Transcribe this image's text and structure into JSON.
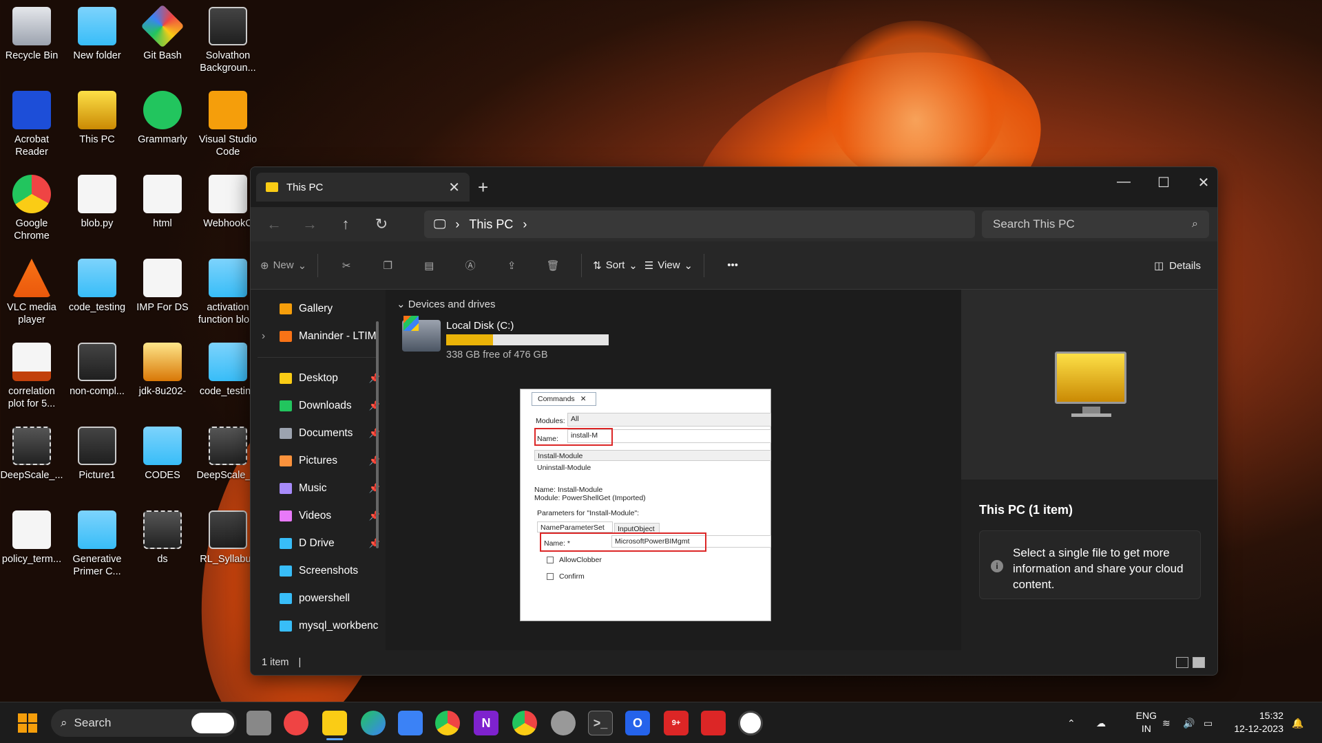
{
  "desktop": {
    "icons": [
      {
        "label": "Recycle Bin",
        "icon": "recycle-bin-icon"
      },
      {
        "label": "New folder",
        "icon": "folder-icon"
      },
      {
        "label": "Git Bash",
        "icon": "git-icon"
      },
      {
        "label": "Solvathon Backgroun...",
        "icon": "image-icon"
      },
      {
        "label": "Acrobat Reader",
        "icon": "acrobat-icon"
      },
      {
        "label": "This PC",
        "icon": "monitor-icon"
      },
      {
        "label": "Grammarly",
        "icon": "grammarly-icon"
      },
      {
        "label": "Visual Studio Code",
        "icon": "vscode-icon"
      },
      {
        "label": "Google Chrome",
        "icon": "chrome-icon"
      },
      {
        "label": "blob.py",
        "icon": "document-icon"
      },
      {
        "label": "html",
        "icon": "document-icon"
      },
      {
        "label": "WebhookC",
        "icon": "document-icon"
      },
      {
        "label": "VLC media player",
        "icon": "vlc-icon"
      },
      {
        "label": "code_testing",
        "icon": "folder-icon"
      },
      {
        "label": "IMP For DS",
        "icon": "document-icon"
      },
      {
        "label": "activation function blo...",
        "icon": "folder-icon"
      },
      {
        "label": "correlation plot for 5...",
        "icon": "word-icon"
      },
      {
        "label": "non-compl...",
        "icon": "image-icon"
      },
      {
        "label": "jdk-8u202-",
        "icon": "archive-icon"
      },
      {
        "label": "code_testing",
        "icon": "folder-icon"
      },
      {
        "label": "DeepScale_...",
        "icon": "video-icon"
      },
      {
        "label": "Picture1",
        "icon": "image-icon"
      },
      {
        "label": "CODES",
        "icon": "folder-icon"
      },
      {
        "label": "DeepScale_...",
        "icon": "video-icon"
      },
      {
        "label": "policy_term...",
        "icon": "document-icon"
      },
      {
        "label": "Generative Primer C...",
        "icon": "folder-icon"
      },
      {
        "label": "ds",
        "icon": "video-icon"
      },
      {
        "label": "RL_Syllabus",
        "icon": "image-icon"
      }
    ]
  },
  "explorer": {
    "tab_title": "This PC",
    "address": "This PC",
    "search_placeholder": "Search This PC",
    "toolbar": {
      "new": "New",
      "sort": "Sort",
      "view": "View",
      "more": "•••",
      "details": "Details"
    },
    "sidebar": [
      {
        "label": "Gallery",
        "color": "#f59e0b",
        "pinned": false
      },
      {
        "label": "Maninder - LTIM",
        "color": "#f97316",
        "pinned": false,
        "expandable": true
      },
      {
        "label": "Desktop",
        "color": "#facc15",
        "pinned": true
      },
      {
        "label": "Downloads",
        "color": "#22c55e",
        "pinned": true
      },
      {
        "label": "Documents",
        "color": "#9ca3af",
        "pinned": true
      },
      {
        "label": "Pictures",
        "color": "#fb923c",
        "pinned": true
      },
      {
        "label": "Music",
        "color": "#a78bfa",
        "pinned": true
      },
      {
        "label": "Videos",
        "color": "#e879f9",
        "pinned": true
      },
      {
        "label": "D Drive",
        "color": "#38bdf8",
        "pinned": true
      },
      {
        "label": "Screenshots",
        "color": "#38bdf8",
        "pinned": false
      },
      {
        "label": "powershell",
        "color": "#38bdf8",
        "pinned": false
      },
      {
        "label": "mysql_workbenc",
        "color": "#38bdf8",
        "pinned": false
      }
    ],
    "group_header": "Devices and drives",
    "drive": {
      "name": "Local Disk (C:)",
      "free_text": "338 GB free of 476 GB",
      "used_fraction": 0.29
    },
    "embedded": {
      "tab": "Commands",
      "modules_label": "Modules:",
      "modules_value": "All",
      "name_label": "Name:",
      "name_value": "install-M",
      "results": [
        "Install-Module",
        "Uninstall-Module"
      ],
      "info_name": "Name: Install-Module",
      "info_module": "Module: PowerShellGet (Imported)",
      "params_label": "Parameters for \"Install-Module\":",
      "param_tabs": [
        "NameParameterSet",
        "InputObject"
      ],
      "param_name_label": "Name: *",
      "param_name_value": "MicrosoftPowerBIMgmt",
      "checkboxes": [
        "AllowClobber",
        "Confirm"
      ]
    },
    "preview": {
      "title": "This PC (1 item)",
      "message": "Select a single file to get more information and share your cloud content."
    },
    "status": "1 item"
  },
  "taskbar": {
    "search_placeholder": "Search",
    "lang_top": "ENG",
    "lang_bottom": "IN",
    "time": "15:32",
    "date": "12-12-2023",
    "badge": "9+"
  }
}
